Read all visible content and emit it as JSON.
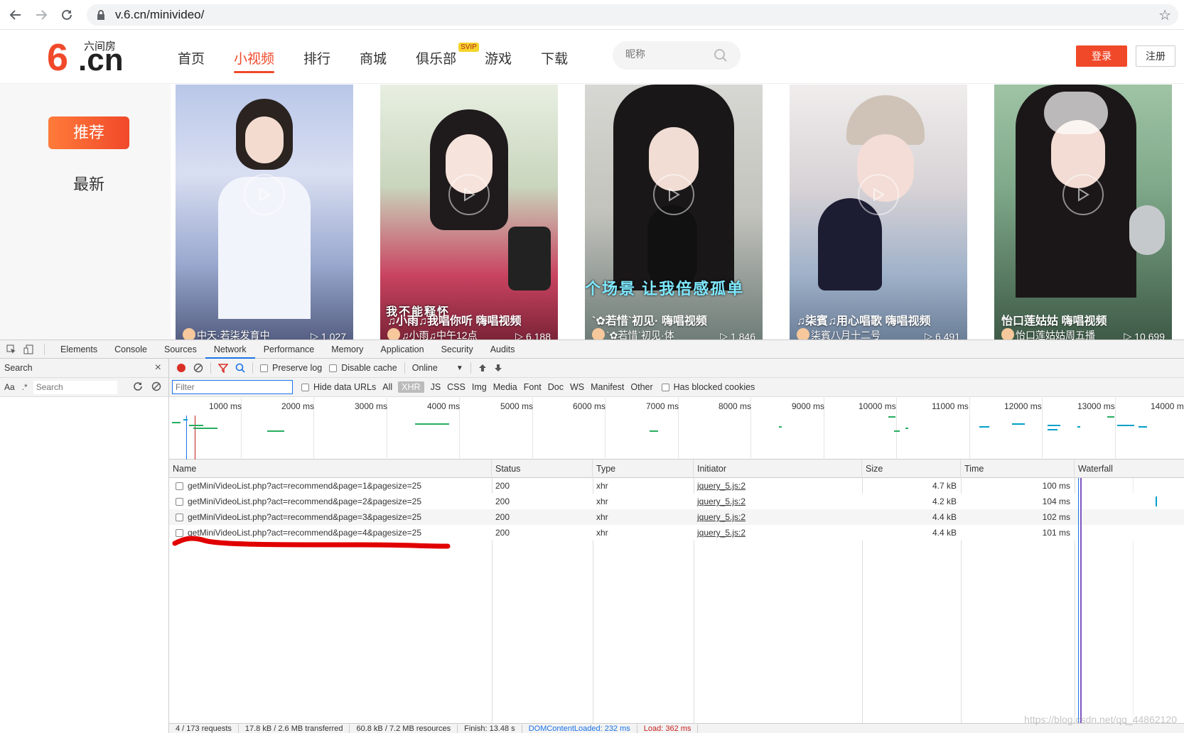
{
  "browser": {
    "url": "v.6.cn/minivideo/"
  },
  "site": {
    "logo_mark": "6",
    "logo_domain": ".cn",
    "logo_cn": "六间房",
    "nav": [
      "首页",
      "小视频",
      "排行",
      "商城",
      "俱乐部",
      "游戏",
      "下载"
    ],
    "active_nav_index": 1,
    "svip_badge": "SVIP",
    "search_placeholder": "昵称",
    "login": "登录",
    "register": "注册",
    "accent_color": "#f0492a"
  },
  "side_menu": {
    "recommend": "推荐",
    "latest": "最新"
  },
  "videos": [
    {
      "title": "",
      "author": "中天·若柒发育中",
      "plays": "1,027"
    },
    {
      "title": "♫小雨♫我唱你听 嗨唱视频",
      "author": "♫小雨♫中午12点",
      "plays": "6,188",
      "overlay": "我不能释怀"
    },
    {
      "title": "`✿若惜`初见· 嗨唱视频",
      "author": "`✿若惜`初见·体",
      "plays": "1,846",
      "overlay": "个场景 让我倍感孤单"
    },
    {
      "title": "♫柒賓♫用心唱歌 嗨唱视频",
      "author": "柒賓八月十二号",
      "plays": "6,491"
    },
    {
      "title": "怡口莲姑姑 嗨唱视频",
      "author": "怡口莲姑姑周五播",
      "plays": "10,699"
    }
  ],
  "devtools": {
    "tabs": [
      "Elements",
      "Console",
      "Sources",
      "Network",
      "Performance",
      "Memory",
      "Application",
      "Security",
      "Audits"
    ],
    "active_tab": "Network",
    "search_pane": {
      "title": "Search",
      "aa": "Aa",
      "regex": ".*",
      "placeholder": "Search"
    },
    "toolbar": {
      "preserve_log": "Preserve log",
      "disable_cache": "Disable cache",
      "throttle": "Online"
    },
    "filter": {
      "placeholder": "Filter",
      "hide_data_urls": "Hide data URLs",
      "types": [
        "All",
        "XHR",
        "JS",
        "CSS",
        "Img",
        "Media",
        "Font",
        "Doc",
        "WS",
        "Manifest",
        "Other"
      ],
      "selected_type": "XHR",
      "blocked_cookies": "Has blocked cookies"
    },
    "timeline_ticks": [
      "1000 ms",
      "2000 ms",
      "3000 ms",
      "4000 ms",
      "5000 ms",
      "6000 ms",
      "7000 ms",
      "8000 ms",
      "9000 ms",
      "10000 ms",
      "11000 ms",
      "12000 ms",
      "13000 ms",
      "14000 m"
    ],
    "columns": [
      "Name",
      "Status",
      "Type",
      "Initiator",
      "Size",
      "Time",
      "Waterfall"
    ],
    "rows": [
      {
        "name": "getMiniVideoList.php?act=recommend&page=1&pagesize=25",
        "status": "200",
        "type": "xhr",
        "initiator": "jquery_5.js:2",
        "size": "4.7 kB",
        "time": "100 ms"
      },
      {
        "name": "getMiniVideoList.php?act=recommend&page=2&pagesize=25",
        "status": "200",
        "type": "xhr",
        "initiator": "jquery_5.js:2",
        "size": "4.2 kB",
        "time": "104 ms"
      },
      {
        "name": "getMiniVideoList.php?act=recommend&page=3&pagesize=25",
        "status": "200",
        "type": "xhr",
        "initiator": "jquery_5.js:2",
        "size": "4.4 kB",
        "time": "102 ms"
      },
      {
        "name": "getMiniVideoList.php?act=recommend&page=4&pagesize=25",
        "status": "200",
        "type": "xhr",
        "initiator": "jquery_5.js:2",
        "size": "4.4 kB",
        "time": "101 ms"
      }
    ],
    "status_bar": {
      "requests": "4 / 173 requests",
      "transferred": "17.8 kB / 2.6 MB transferred",
      "resources": "60.8 kB / 7.2 MB resources",
      "finish": "Finish: 13.48 s",
      "dom_loaded": "DOMContentLoaded: 232 ms",
      "load": "Load: 362 ms"
    }
  },
  "watermark": "https://blog.csdn.net/qq_44862120"
}
